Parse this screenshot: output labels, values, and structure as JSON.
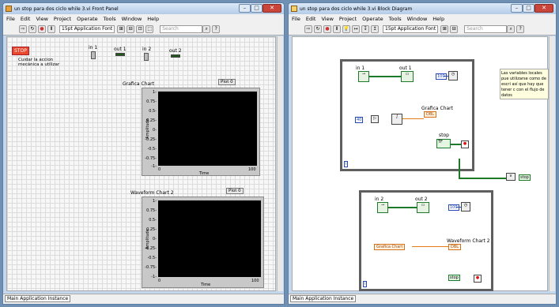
{
  "front": {
    "title": "un stop para dos ciclo while 3.vi Front Panel",
    "menu": [
      "File",
      "Edit",
      "View",
      "Project",
      "Operate",
      "Tools",
      "Window",
      "Help"
    ],
    "font": "15pt Application Font",
    "search": "Search",
    "stop": "STOP",
    "comment": "Cuidar la accion mecánica a utilizar",
    "in1": "in 1",
    "out1": "out 1",
    "in2": "in 2",
    "out2": "out 2",
    "chart1": {
      "title": "Grafica Chart",
      "plot": "Plot 0",
      "ylabel": "Amplitude",
      "xlabel": "Time",
      "yticks": [
        "1-",
        "0.75-",
        "0.5-",
        "0.25-",
        "0-",
        "-0.25-",
        "-0.5-",
        "-0.75-",
        "-1-"
      ],
      "x0": "0",
      "x1": "100"
    },
    "chart2": {
      "title": "Waveform Chart 2",
      "plot": "Plot 0",
      "ylabel": "Amplitude",
      "xlabel": "Time",
      "yticks": [
        "1-",
        "0.75-",
        "0.5-",
        "0.25-",
        "0-",
        "-0.25-",
        "-0.5-",
        "-0.75-",
        "-1-"
      ],
      "x0": "0",
      "x1": "100"
    },
    "status": "Main Application Instance"
  },
  "block": {
    "title": "un stop para dos ciclo while 3.vi Block Diagram",
    "menu": [
      "File",
      "Edit",
      "View",
      "Project",
      "Operate",
      "Tools",
      "Window",
      "Help"
    ],
    "font": "15pt Application Font",
    "search": "Search",
    "in1": "in 1",
    "out1": "out 1",
    "in2": "in 2",
    "out2": "out 2",
    "c100a": "100",
    "c100b": "100",
    "c40": "40",
    "grafica": "Grafica Chart",
    "stop": "stop",
    "note": "Las variables locales pue utilizarse como de escri así que hay que tener c con el flujo de datos",
    "stoplocal": "stop",
    "waveform": "Waveform Chart 2",
    "graficalocal": "Grafica Chart",
    "stoplocal2": "stop",
    "iter": "i",
    "status": "Main Application Instance"
  }
}
